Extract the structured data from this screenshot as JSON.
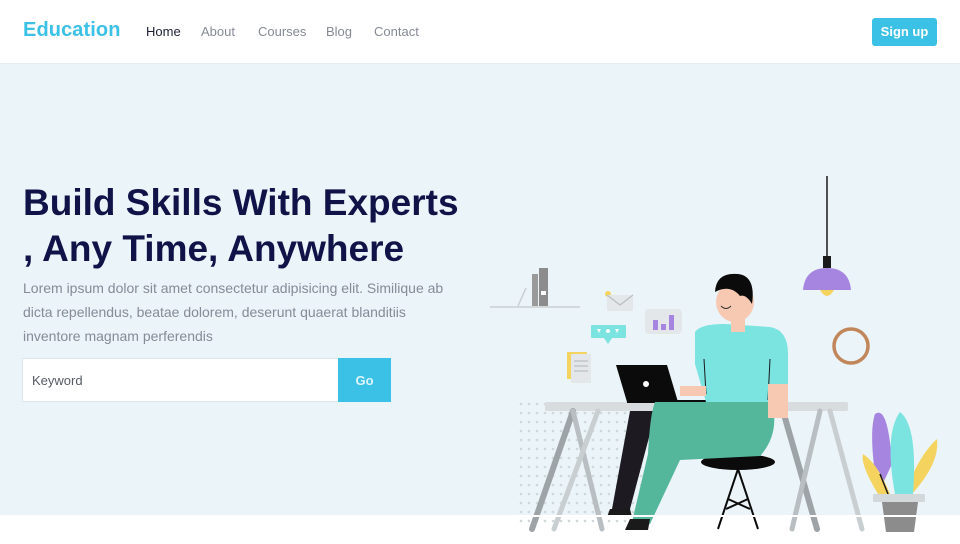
{
  "header": {
    "brand": "Education",
    "nav": [
      "Home",
      "About",
      "Courses",
      "Blog",
      "Contact"
    ],
    "active_nav": "Home",
    "signup_label": "Sign up"
  },
  "hero": {
    "headline_line1": "Build Skills With Experts",
    "headline_line2": ", Any Time, Anywhere",
    "description": "Lorem ipsum dolor sit amet consectetur adipisicing elit. Similique ab dicta repellendus, beatae dolorem, deserunt quaerat blanditiis inventore magnam perferendis",
    "search": {
      "placeholder": "Keyword",
      "value": "",
      "button_label": "Go"
    }
  },
  "colors": {
    "accent": "#3cc1e6",
    "headline": "#0f1348",
    "hero_bg": "#ebf4f8",
    "shirt": "#7be3e0",
    "pants": "#54b79b",
    "lamp": "#b08ee6"
  }
}
